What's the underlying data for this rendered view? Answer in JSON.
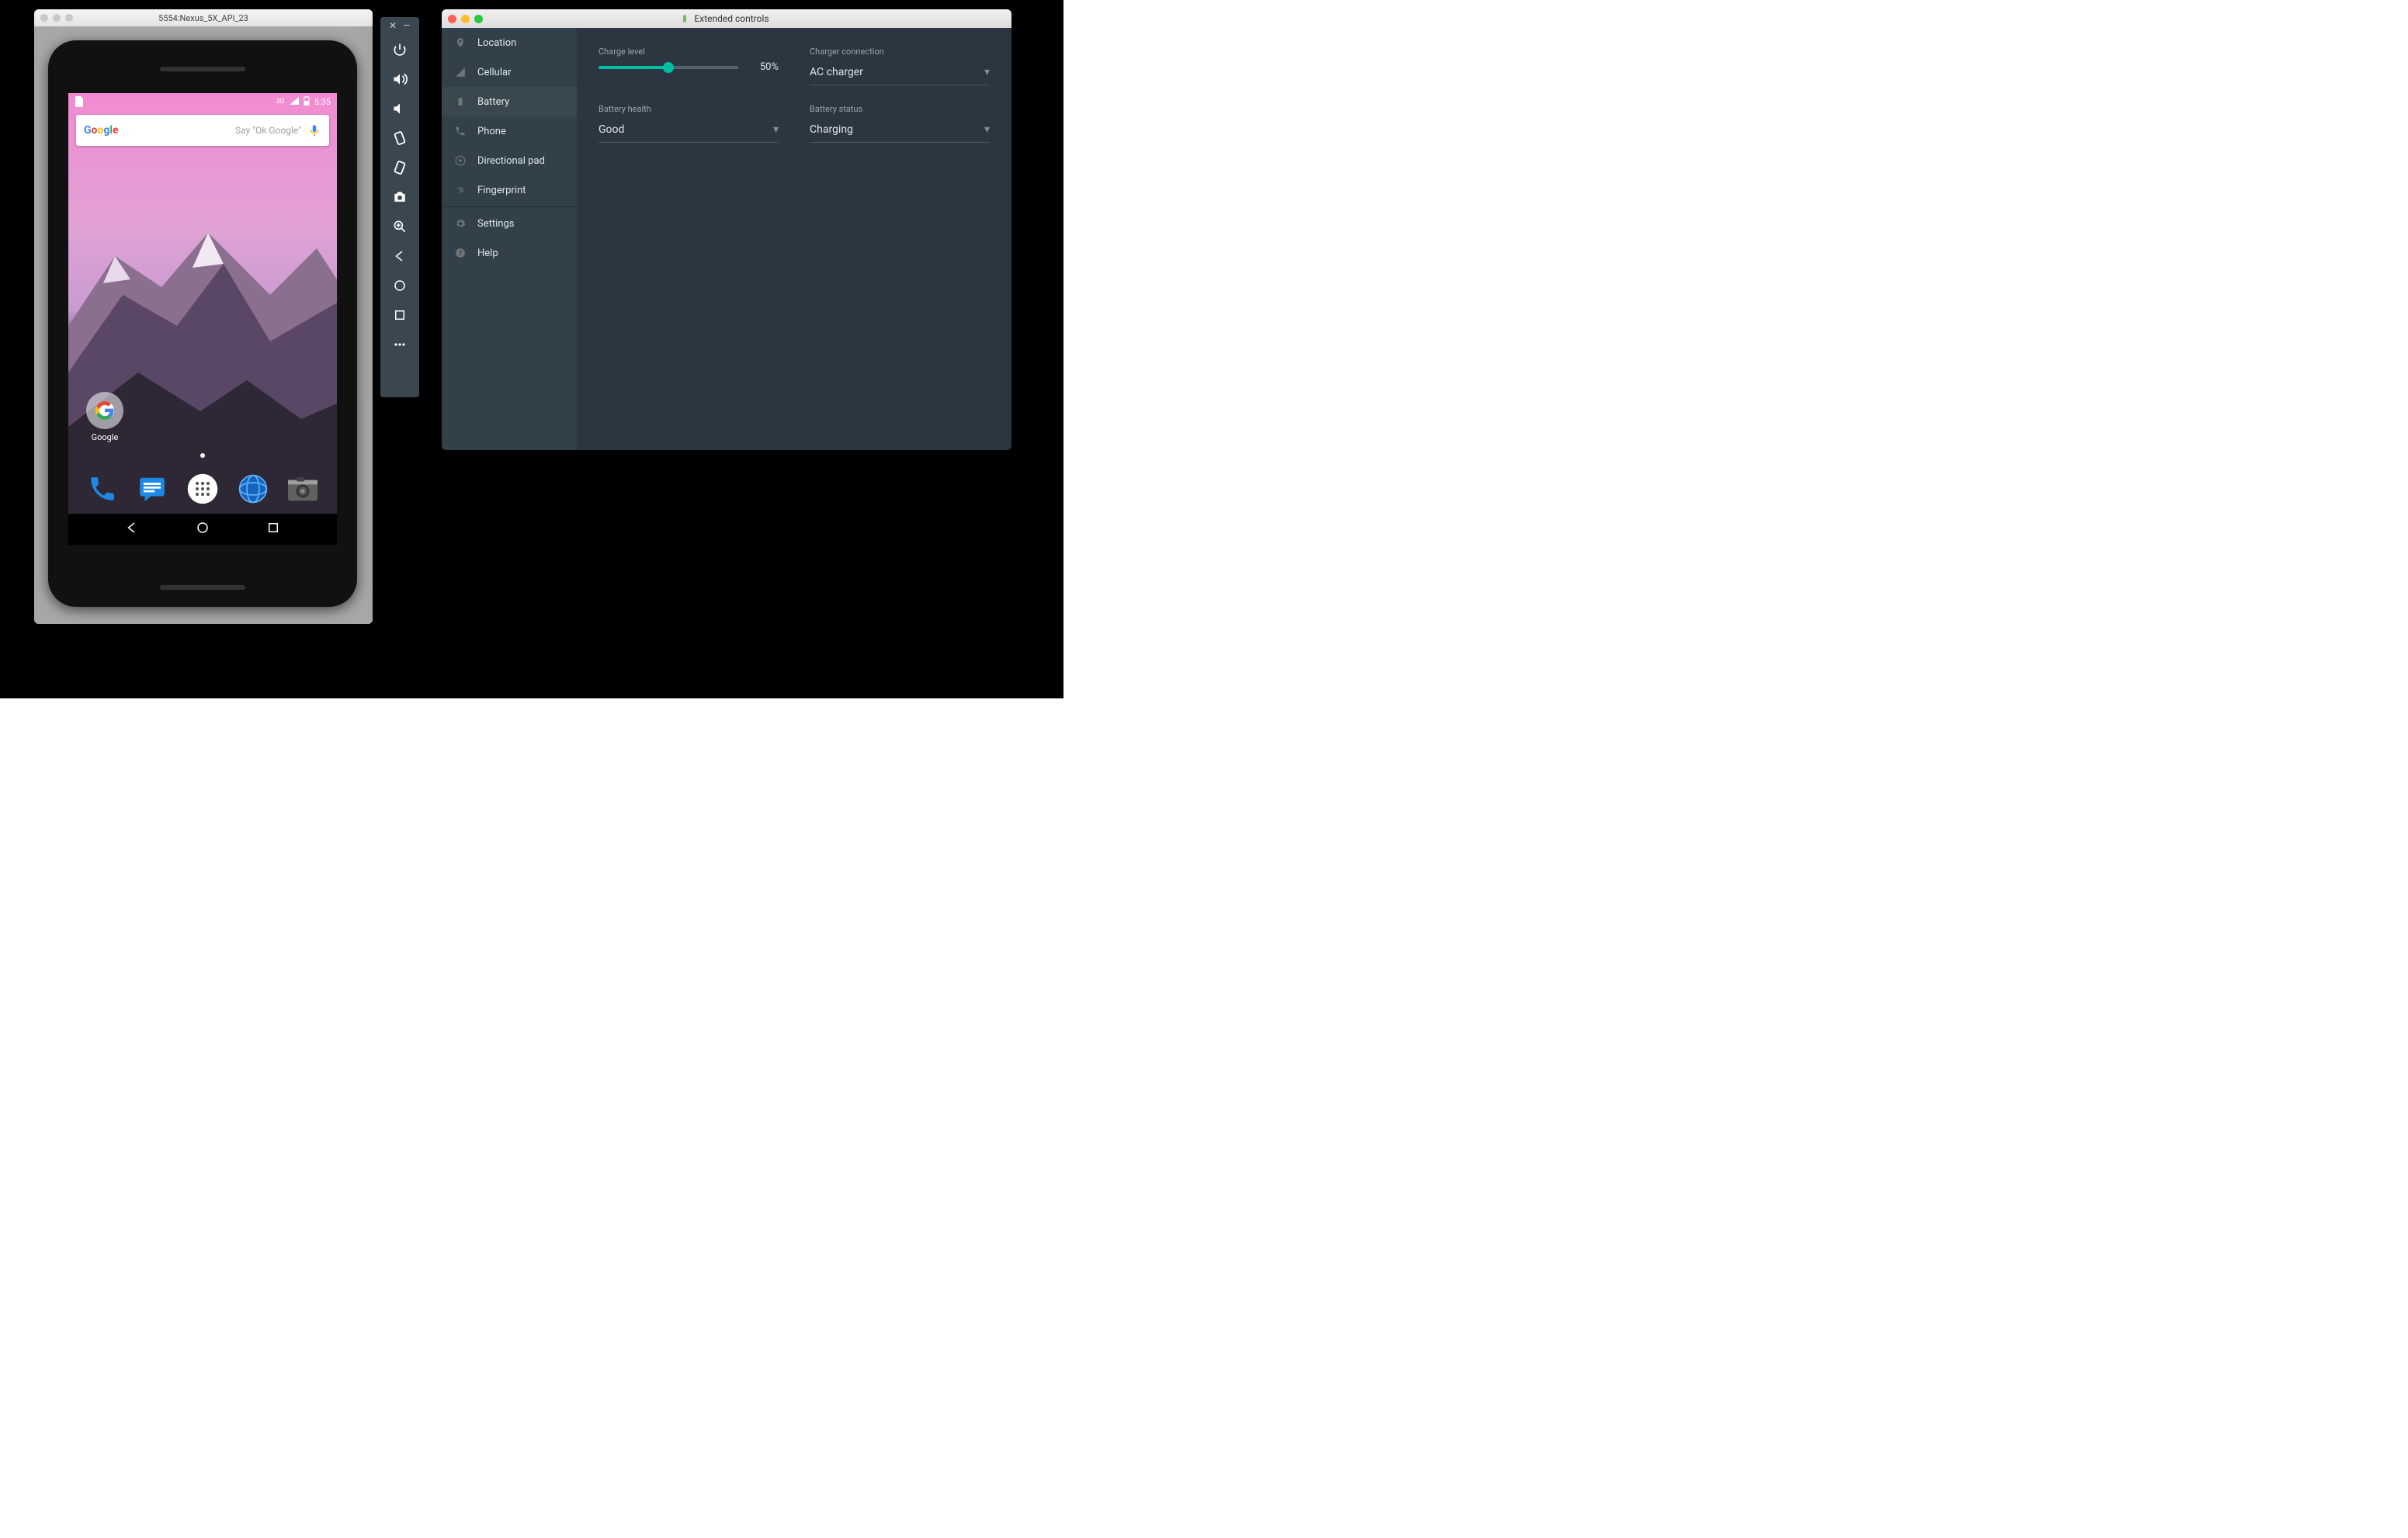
{
  "emulator": {
    "window_title": "5554:Nexus_5X_API_23",
    "status": {
      "time": "5:35",
      "network_label": "3G",
      "sim_icon": "sim-card-icon"
    },
    "search": {
      "logo_text": "Google",
      "hint": "Say \"Ok Google\""
    },
    "folder": {
      "label": "Google"
    },
    "dock_icons": [
      "phone-icon",
      "messages-icon",
      "apps-icon",
      "browser-icon",
      "camera-icon"
    ]
  },
  "toolbar_icons": [
    "power-icon",
    "volume-up-icon",
    "volume-down-icon",
    "rotate-left-icon",
    "rotate-right-icon",
    "camera-icon",
    "zoom-icon",
    "back-icon",
    "home-icon",
    "overview-icon",
    "more-icon"
  ],
  "extended": {
    "window_title": "Extended controls",
    "sidebar": [
      {
        "icon": "location-icon",
        "label": "Location"
      },
      {
        "icon": "cellular-icon",
        "label": "Cellular"
      },
      {
        "icon": "battery-icon",
        "label": "Battery",
        "active": true
      },
      {
        "icon": "phone-icon",
        "label": "Phone"
      },
      {
        "icon": "dpad-icon",
        "label": "Directional pad"
      },
      {
        "icon": "fingerprint-icon",
        "label": "Fingerprint"
      },
      {
        "icon": "settings-icon",
        "label": "Settings"
      },
      {
        "icon": "help-icon",
        "label": "Help"
      }
    ],
    "battery": {
      "charge_level_label": "Charge level",
      "charge_level_value": 50,
      "charge_level_display": "50%",
      "charger_connection_label": "Charger connection",
      "charger_connection_value": "AC charger",
      "battery_health_label": "Battery health",
      "battery_health_value": "Good",
      "battery_status_label": "Battery status",
      "battery_status_value": "Charging"
    }
  }
}
